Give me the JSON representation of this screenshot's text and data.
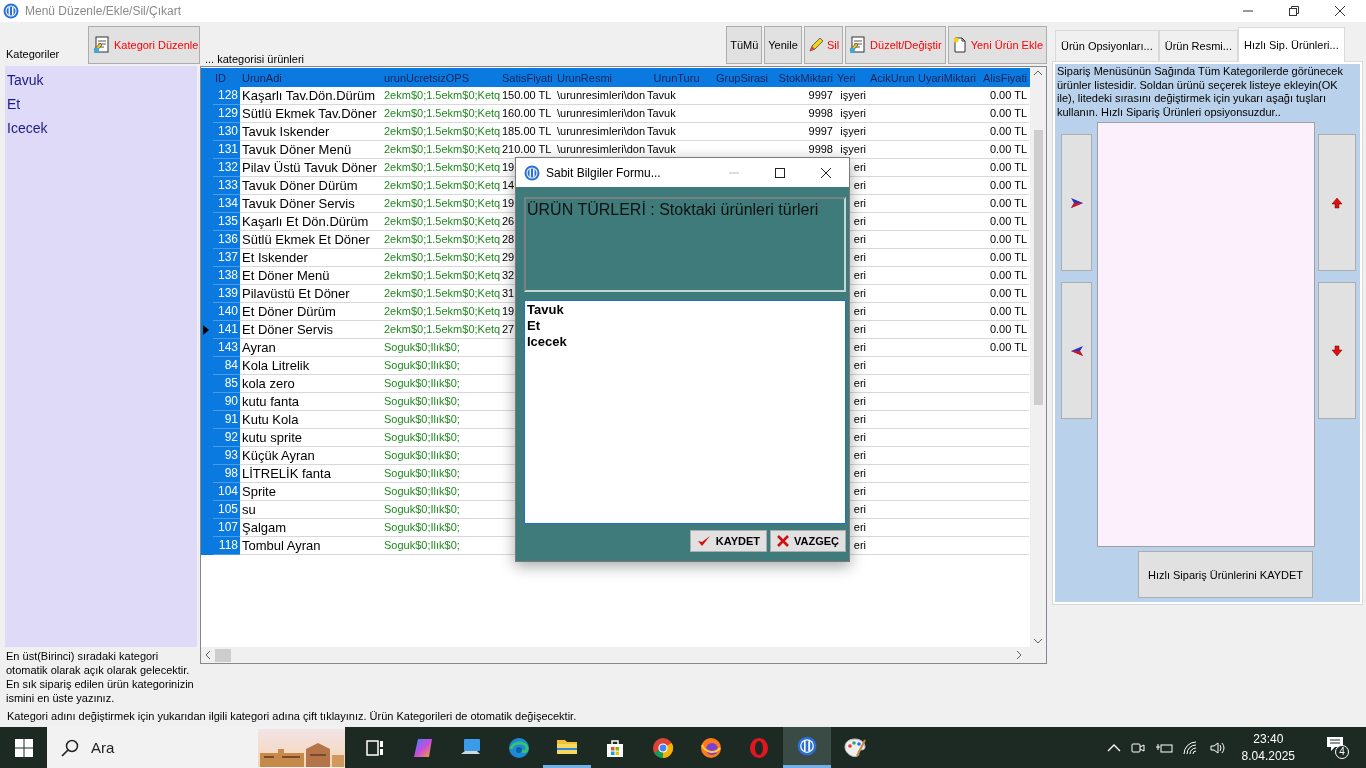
{
  "window": {
    "title": "Menü Düzenle/Ekle/Sil/Çıkart"
  },
  "categories": {
    "label": "Kategoriler",
    "edit_button": "Kategori Düzenle",
    "items": [
      {
        "label": "Tavuk"
      },
      {
        "label": "Et"
      },
      {
        "label": "Icecek"
      }
    ],
    "note": "En üst(Birinci) sıradaki kategori otomatik olarak açık olarak gelecektir. En sık sipariş edilen ürün kategorinizin ismini en üste yazınız."
  },
  "products": {
    "label": "... kategorisi ürünleri",
    "buttons": [
      {
        "label": "TüMü",
        "kind": "plain"
      },
      {
        "label": "Yenile",
        "kind": "plain"
      },
      {
        "label": "Sil",
        "kind": "delete"
      },
      {
        "label": "Düzelt/Değiştir",
        "kind": "edit"
      },
      {
        "label": "Yeni Ürün Ekle",
        "kind": "new"
      }
    ],
    "table": {
      "columns": [
        {
          "label": "ID"
        },
        {
          "label": "UrunAdi"
        },
        {
          "label": "urunUcretsizOPS"
        },
        {
          "label": "SatisFiyati"
        },
        {
          "label": "UrunResmi"
        },
        {
          "label": "UrunTuru"
        },
        {
          "label": "GrupSirasi"
        },
        {
          "label": "StokMiktari"
        },
        {
          "label": "Yeri"
        },
        {
          "label": "AcikUrun"
        },
        {
          "label": "UyariMiktari"
        },
        {
          "label": "AlisFiyati"
        }
      ],
      "rows": [
        {
          "current": false,
          "id": "128",
          "urun_adi": "Kaşarlı Tav.Dön.Dürüm",
          "ops": "2ekm$0;1.5ekm$0;Ketq",
          "satis_fiyati": "150.00 TL",
          "urun_resmi": "\\urunresimleri\\don",
          "urun_turu": "Tavuk",
          "stok_miktari": "9997",
          "yeri": "işyeri",
          "alis_fiyati": "0.00 TL"
        },
        {
          "current": false,
          "id": "129",
          "urun_adi": "Sütlü Ekmek Tav.Döner",
          "ops": "2ekm$0;1.5ekm$0;Ketq",
          "satis_fiyati": "160.00 TL",
          "urun_resmi": "\\urunresimleri\\don",
          "urun_turu": "Tavuk",
          "stok_miktari": "9998",
          "yeri": "işyeri",
          "alis_fiyati": "0.00 TL"
        },
        {
          "current": false,
          "id": "130",
          "urun_adi": "Tavuk Iskender",
          "ops": "2ekm$0;1.5ekm$0;Ketq",
          "satis_fiyati": "185.00 TL",
          "urun_resmi": "\\urunresimleri\\don",
          "urun_turu": "Tavuk",
          "stok_miktari": "9997",
          "yeri": "işyeri",
          "alis_fiyati": "0.00 TL"
        },
        {
          "current": false,
          "id": "131",
          "urun_adi": "Tavuk Döner Menü",
          "ops": "2ekm$0;1.5ekm$0;Ketq",
          "satis_fiyati": "210.00 TL",
          "urun_resmi": "\\urunresimleri\\don",
          "urun_turu": "Tavuk",
          "stok_miktari": "9998",
          "yeri": "işyeri",
          "alis_fiyati": "0.00 TL"
        },
        {
          "current": false,
          "id": "132",
          "urun_adi": "Pilav Üstü Tavuk Döner",
          "ops": "2ekm$0;1.5ekm$0;Ketq",
          "satis_fiyati": "19",
          "yeri": "eri",
          "alis_fiyati": "0.00 TL"
        },
        {
          "current": false,
          "id": "133",
          "urun_adi": "Tavuk Döner Dürüm",
          "ops": "2ekm$0;1.5ekm$0;Ketq",
          "satis_fiyati": "14",
          "yeri": "eri",
          "alis_fiyati": "0.00 TL"
        },
        {
          "current": false,
          "id": "134",
          "urun_adi": "Tavuk Döner Servis",
          "ops": "2ekm$0;1.5ekm$0;Ketq",
          "satis_fiyati": "19",
          "yeri": "eri",
          "alis_fiyati": "0.00 TL"
        },
        {
          "current": false,
          "id": "135",
          "urun_adi": "Kaşarlı Et Dön.Dürüm",
          "ops": "2ekm$0;1.5ekm$0;Ketq",
          "satis_fiyati": "26",
          "yeri": "eri",
          "alis_fiyati": "0.00 TL"
        },
        {
          "current": false,
          "id": "136",
          "urun_adi": "Sütlü Ekmek Et Döner",
          "ops": "2ekm$0;1.5ekm$0;Ketq",
          "satis_fiyati": "28",
          "yeri": "eri",
          "alis_fiyati": "0.00 TL"
        },
        {
          "current": false,
          "id": "137",
          "urun_adi": "Et Iskender",
          "ops": "2ekm$0;1.5ekm$0;Ketq",
          "satis_fiyati": "29",
          "yeri": "eri",
          "alis_fiyati": "0.00 TL"
        },
        {
          "current": false,
          "id": "138",
          "urun_adi": "Et Döner Menü",
          "ops": "2ekm$0;1.5ekm$0;Ketq",
          "satis_fiyati": "32",
          "yeri": "eri",
          "alis_fiyati": "0.00 TL"
        },
        {
          "current": false,
          "id": "139",
          "urun_adi": "Pilavüstü Et Döner",
          "ops": "2ekm$0;1.5ekm$0;Ketq",
          "satis_fiyati": "31",
          "yeri": "eri",
          "alis_fiyati": "0.00 TL"
        },
        {
          "current": false,
          "id": "140",
          "urun_adi": "Et Döner Dürüm",
          "ops": "2ekm$0;1.5ekm$0;Ketq",
          "satis_fiyati": "19",
          "yeri": "eri",
          "alis_fiyati": "0.00 TL"
        },
        {
          "current": true,
          "id": "141",
          "urun_adi": "Et Döner Servis",
          "ops": "2ekm$0;1.5ekm$0;Ketq",
          "satis_fiyati": "27",
          "yeri": "eri",
          "alis_fiyati": "0.00 TL"
        },
        {
          "current": false,
          "id": "143",
          "urun_adi": "Ayran",
          "ops": "Soguk$0;Ilık$0;",
          "yeri": "eri",
          "alis_fiyati": "0.00 TL"
        },
        {
          "current": false,
          "id": "84",
          "urun_adi": "Kola Litrelik",
          "ops": "Soguk$0;Ilık$0;",
          "yeri": "eri"
        },
        {
          "current": false,
          "id": "85",
          "urun_adi": "kola zero",
          "ops": "Soguk$0;Ilık$0;",
          "yeri": "eri"
        },
        {
          "current": false,
          "id": "90",
          "urun_adi": "kutu fanta",
          "ops": "Soguk$0;Ilık$0;",
          "yeri": "eri"
        },
        {
          "current": false,
          "id": "91",
          "urun_adi": "Kutu Kola",
          "ops": "Soguk$0;Ilık$0;",
          "yeri": "eri"
        },
        {
          "current": false,
          "id": "92",
          "urun_adi": "kutu sprite",
          "ops": "Soguk$0;Ilık$0;",
          "yeri": "eri"
        },
        {
          "current": false,
          "id": "93",
          "urun_adi": "Küçük Ayran",
          "ops": "Soguk$0;Ilık$0;",
          "yeri": "eri"
        },
        {
          "current": false,
          "id": "98",
          "urun_adi": "LİTRELİK fanta",
          "ops": "Soguk$0;Ilık$0;",
          "yeri": "eri"
        },
        {
          "current": false,
          "id": "104",
          "urun_adi": "Sprite",
          "ops": "Soguk$0;Ilık$0;",
          "yeri": "eri"
        },
        {
          "current": false,
          "id": "105",
          "urun_adi": "su",
          "ops": "Soguk$0;Ilık$0;",
          "yeri": "eri"
        },
        {
          "current": false,
          "id": "107",
          "urun_adi": "Şalgam",
          "ops": "Soguk$0;Ilık$0;",
          "yeri": "eri"
        },
        {
          "current": false,
          "id": "118",
          "urun_adi": "Tombul Ayran",
          "ops": "Soguk$0;Ilık$0;",
          "yeri": "eri"
        }
      ]
    }
  },
  "side_panel": {
    "tabs": [
      {
        "label": "Ürün Opsiyonları...",
        "selected": false
      },
      {
        "label": "Ürün Resmi...",
        "selected": false
      },
      {
        "label": "Hızlı Sip. Ürünleri...",
        "selected": true
      }
    ],
    "description": "Sipariş Menüsünün Sağında Tüm Kategorilerde görünecek ürünler listesidir. Soldan ürünü seçerek listeye ekleyin(OK ile), litedeki sırasını değiştirmek için yukarı aşağı tuşları kullanın. Hızlı Sipariş Ürünleri opsiyonsuzdur..",
    "save_button": "Hızlı Sipariş Ürünlerini KAYDET"
  },
  "footer_note": "Kategori adını değiştirmek için yukarıdan ilgili kategori adına çift tıklayınız. Ürün Kategorileri de otomatik değişecektir.",
  "dialog": {
    "title": "Sabit Bilgiler Formu...",
    "heading": "ÜRÜN TÜRLERİ : Stoktaki ürünleri türleri",
    "text": "Tavuk\nEt\nIcecek",
    "buttons": [
      {
        "label": "KAYDET",
        "kind": "save"
      },
      {
        "label": "VAZGEÇ",
        "kind": "cancel"
      }
    ]
  },
  "taskbar": {
    "search": {
      "placeholder": "Ara"
    },
    "apps": [
      {
        "kind": "task-view",
        "selected": false,
        "running": false
      },
      {
        "kind": "copilot",
        "selected": false,
        "running": false
      },
      {
        "kind": "computer",
        "selected": false,
        "running": false
      },
      {
        "kind": "edge",
        "selected": false,
        "running": false
      },
      {
        "kind": "folder",
        "selected": false,
        "running": true
      },
      {
        "kind": "store",
        "selected": false,
        "running": false
      },
      {
        "kind": "chrome",
        "selected": false,
        "running": false
      },
      {
        "kind": "firefox",
        "selected": false,
        "running": false
      },
      {
        "kind": "opera",
        "selected": false,
        "running": false
      },
      {
        "kind": "app",
        "selected": true,
        "running": true
      },
      {
        "kind": "paint",
        "selected": false,
        "running": false
      }
    ],
    "clock": {
      "time": "23:40",
      "date": "8.04.2025"
    },
    "notifications": "4"
  }
}
